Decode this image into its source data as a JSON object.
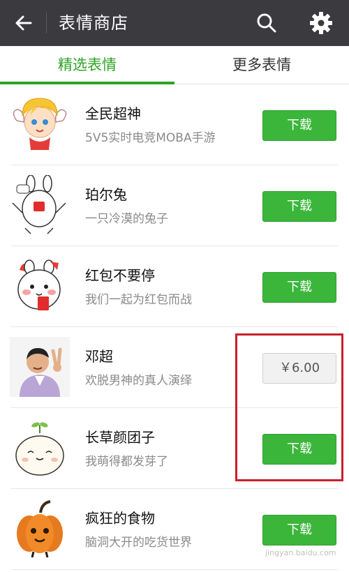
{
  "header": {
    "title": "表情商店"
  },
  "tabs": [
    {
      "label": "精选表情",
      "active": true
    },
    {
      "label": "更多表情",
      "active": false
    }
  ],
  "items": [
    {
      "name": "全民超神",
      "desc": "5V5实时电竞MOBA手游",
      "action": "下载",
      "icon": "cherub-sticker"
    },
    {
      "name": "珀尔兔",
      "desc": "一只冷漠的兔子",
      "action": "下载",
      "icon": "rabbit-sticker"
    },
    {
      "name": "红包不要停",
      "desc": "我们一起为红包而战",
      "action": "下载",
      "icon": "bunny-redpacket-sticker"
    },
    {
      "name": "邓超",
      "desc": "欢脱男神的真人演绎",
      "action": "￥6.00",
      "icon": "person-photo"
    },
    {
      "name": "长草颜团子",
      "desc": "我萌得都发芽了",
      "action": "下载",
      "icon": "sprout-dumpling-sticker"
    },
    {
      "name": "疯狂的食物",
      "desc": "脑洞大开的吃货世界",
      "action": "下载",
      "icon": "pumpkin-sticker"
    }
  ],
  "watermark": "jingyan.baidu.com",
  "colors": {
    "accent": "#2fa326",
    "button": "#3bb63b",
    "topbar": "#3a3a3f",
    "highlight": "#c8202a"
  }
}
